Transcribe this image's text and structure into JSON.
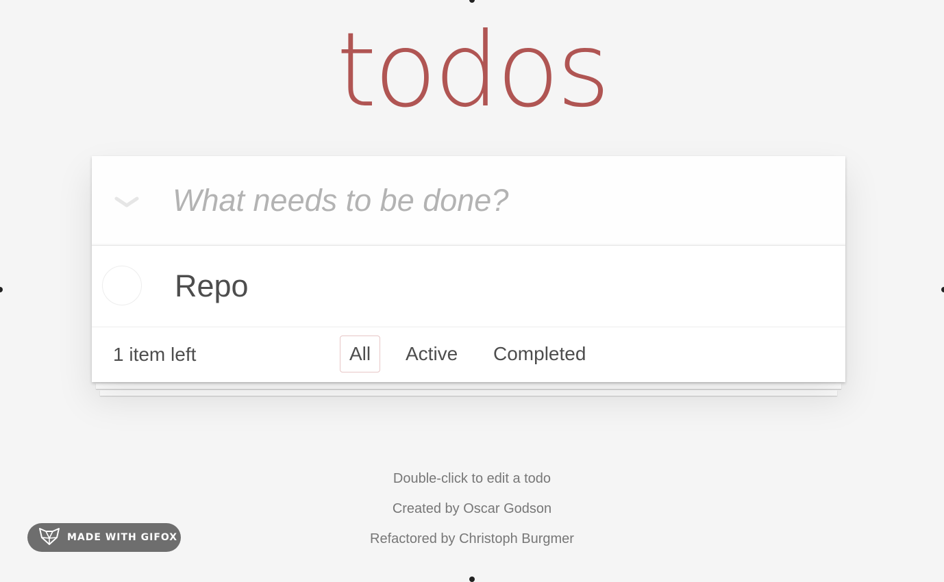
{
  "app": {
    "title": "todos"
  },
  "header": {
    "new_todo_placeholder": "What needs to be done?",
    "toggle_icon": "chevron-down-icon"
  },
  "todos": [
    {
      "label": "Repo",
      "completed": false
    }
  ],
  "footer": {
    "count_text": "1 item left",
    "filters": [
      {
        "label": "All",
        "selected": true
      },
      {
        "label": "Active",
        "selected": false
      },
      {
        "label": "Completed",
        "selected": false
      }
    ]
  },
  "info": {
    "line1": "Double-click to edit a todo",
    "line2": "Created by Oscar Godson",
    "line3": "Refactored by Christoph Burgmer"
  },
  "badge": {
    "text": "MADE WITH GIFOX",
    "icon": "fox-icon"
  },
  "colors": {
    "title": "#b05553",
    "background": "#f5f5f5",
    "selected_filter_border": "#e7c6c6",
    "badge": "#6e6e6e"
  }
}
